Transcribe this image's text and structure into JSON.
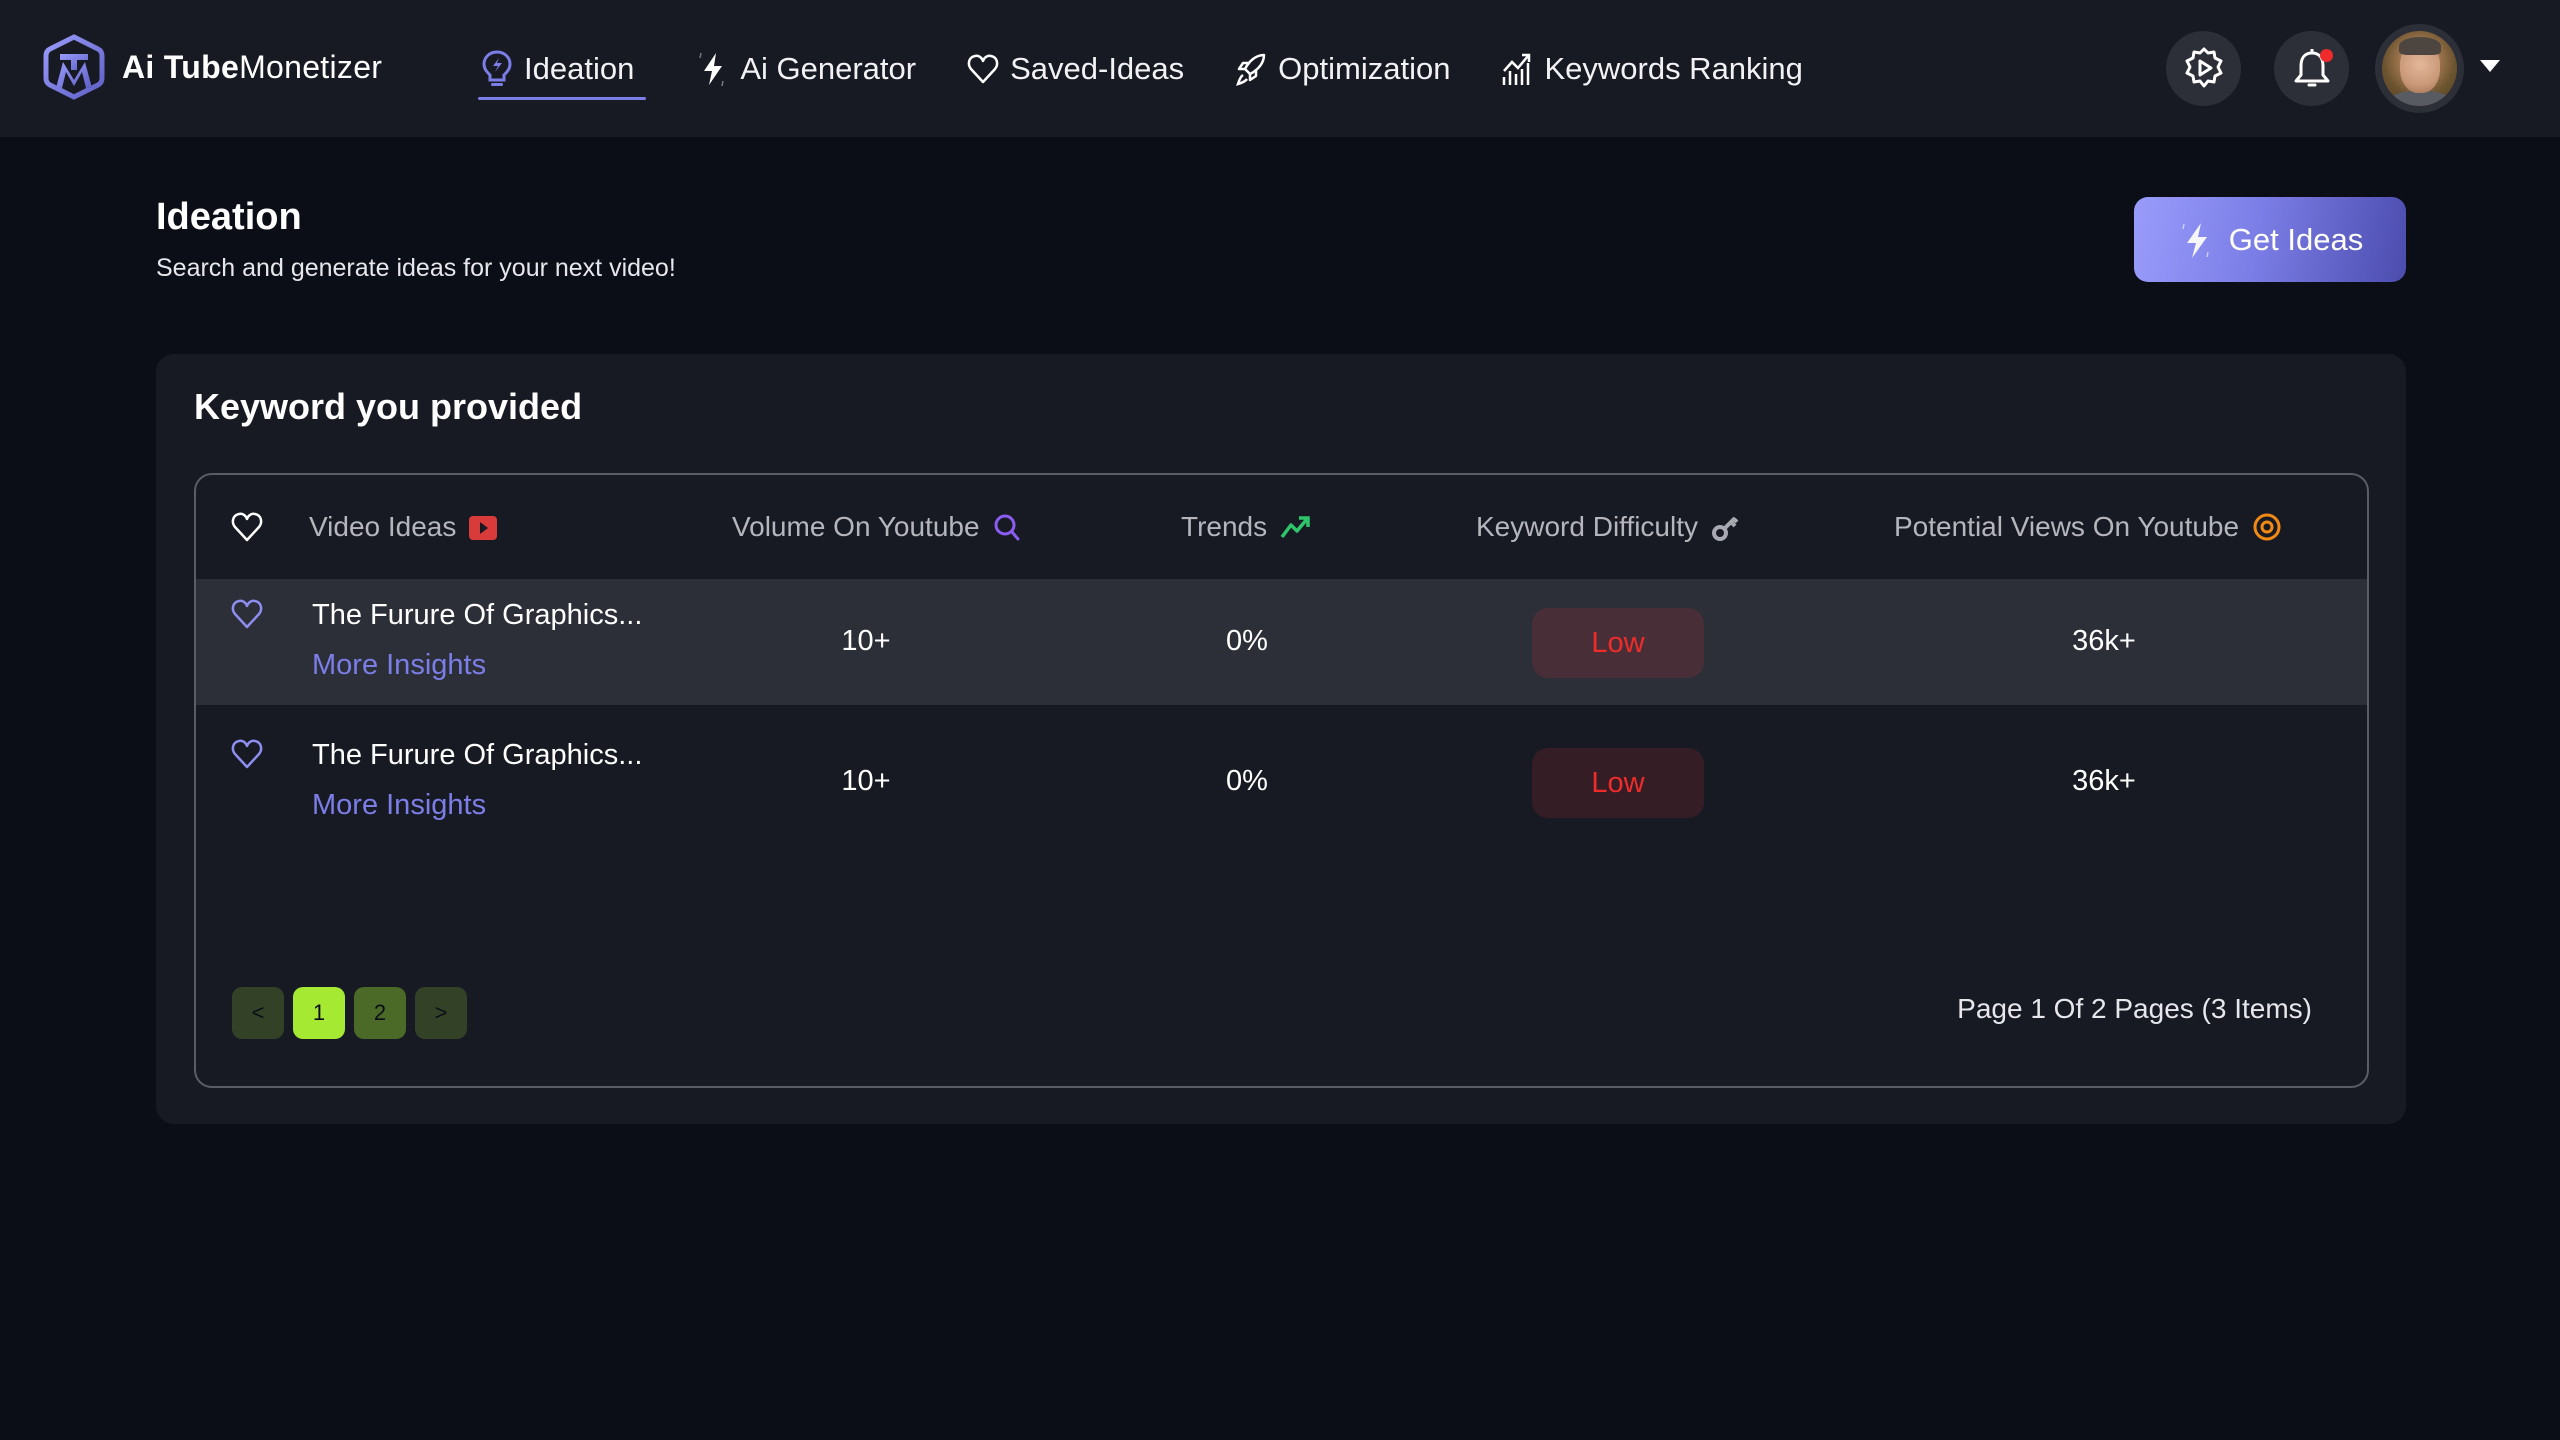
{
  "app": {
    "brand_bold": "Ai Tube",
    "brand_regular": "Monetizer",
    "logo_icon": "tm-hexagon-logo"
  },
  "nav": {
    "items": [
      {
        "label": "Ideation",
        "icon": "lightbulb-icon",
        "active": true
      },
      {
        "label": "Ai Generator",
        "icon": "lightning-icon",
        "active": false
      },
      {
        "label": "Saved-Ideas",
        "icon": "heart-icon",
        "active": false
      },
      {
        "label": "Optimization",
        "icon": "rocket-icon",
        "active": false
      },
      {
        "label": "Keywords Ranking",
        "icon": "chart-trend-icon",
        "active": false
      }
    ]
  },
  "header_actions": {
    "settings_icon": "gear-play-icon",
    "notifications_icon": "bell-icon",
    "has_notification": true,
    "profile_menu_icon": "caret-down-icon"
  },
  "page": {
    "title": "Ideation",
    "subtitle": "Search and generate ideas for your next video!",
    "primary_button": "Get Ideas"
  },
  "card": {
    "title": "Keyword you provided",
    "columns": [
      {
        "label": "Video Ideas",
        "icon": "youtube-icon"
      },
      {
        "label": "Volume On Youtube",
        "icon": "search-icon"
      },
      {
        "label": "Trends",
        "icon": "trend-up-icon"
      },
      {
        "label": "Keyword Difficulty",
        "icon": "key-icon"
      },
      {
        "label": "Potential Views On Youtube",
        "icon": "eye-icon"
      }
    ],
    "rows": [
      {
        "title": "The Furure Of Graphics...",
        "link": "More Insights",
        "volume": "10+",
        "trend": "0%",
        "difficulty": "Low",
        "views": "36k+",
        "highlighted": true
      },
      {
        "title": "The Furure Of Graphics...",
        "link": "More Insights",
        "volume": "10+",
        "trend": "0%",
        "difficulty": "Low",
        "views": "36k+",
        "highlighted": false
      }
    ],
    "pagination": {
      "prev": "<",
      "pages": [
        "1",
        "2"
      ],
      "current": "1",
      "next": ">",
      "info": "Page 1 Of 2 Pages (3 Items)"
    }
  },
  "colors": {
    "accent": "#7b7ee6",
    "background": "#0b0e16",
    "surface": "#181a23",
    "row_highlight": "#2c2e38",
    "difficulty_low": "#ef2b2b",
    "pager_active": "#a6e932",
    "youtube_red": "#d93a3a",
    "trend_green": "#2ec46b",
    "views_orange": "#f08a14"
  }
}
